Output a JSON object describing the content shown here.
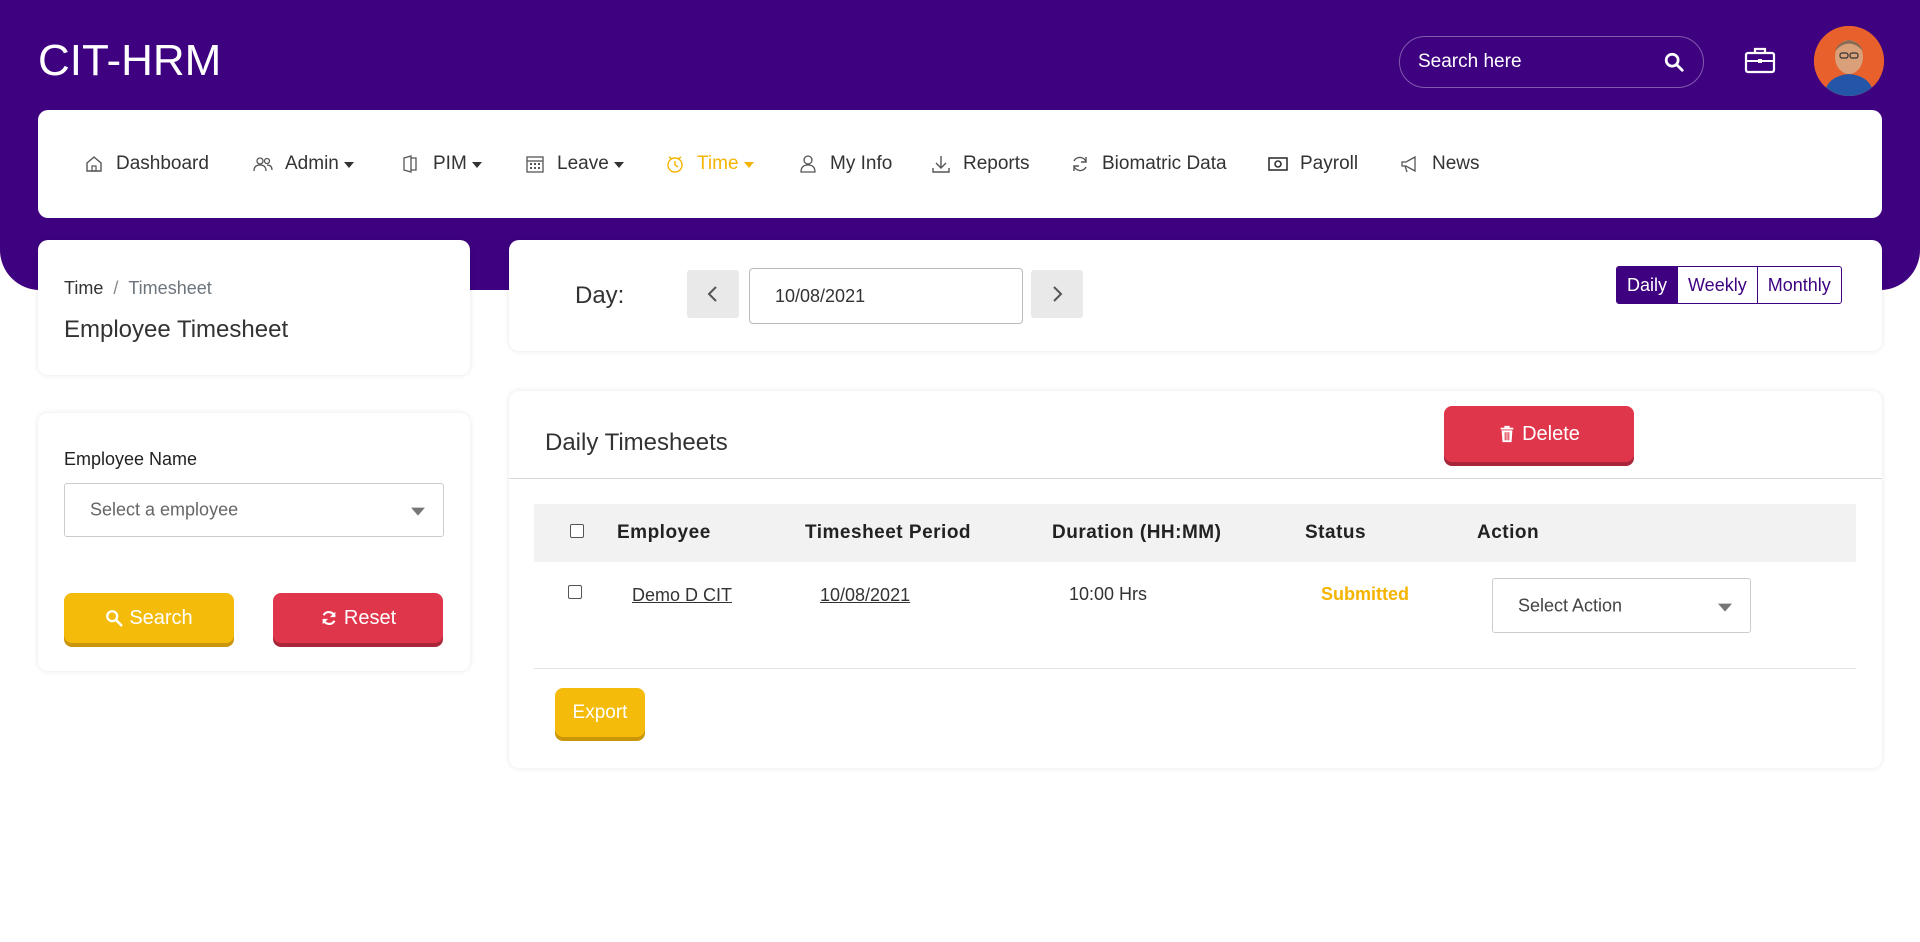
{
  "app": {
    "title": "CIT-HRM"
  },
  "header": {
    "search_placeholder": "Search here"
  },
  "nav": {
    "items": [
      {
        "label": "Dashboard",
        "icon": "home-icon"
      },
      {
        "label": "Admin",
        "icon": "users-icon",
        "dropdown": true
      },
      {
        "label": "PIM",
        "icon": "pim-icon",
        "dropdown": true
      },
      {
        "label": "Leave",
        "icon": "calendar-icon",
        "dropdown": true
      },
      {
        "label": "Time",
        "icon": "clock-icon",
        "dropdown": true,
        "active": true
      },
      {
        "label": "My Info",
        "icon": "user-icon"
      },
      {
        "label": "Reports",
        "icon": "download-icon"
      },
      {
        "label": "Biomatric Data",
        "icon": "refresh-icon"
      },
      {
        "label": "Payroll",
        "icon": "money-icon"
      },
      {
        "label": "News",
        "icon": "megaphone-icon"
      }
    ]
  },
  "breadcrumb": {
    "parent": "Time",
    "separator": "/",
    "current": "Timesheet"
  },
  "page": {
    "title": "Employee Timesheet"
  },
  "filter": {
    "employee_label": "Employee Name",
    "employee_placeholder": "Select a employee",
    "search_label": "Search",
    "reset_label": "Reset"
  },
  "day_selector": {
    "label": "Day:",
    "date": "10/08/2021",
    "views": [
      "Daily",
      "Weekly",
      "Monthly"
    ],
    "selected_view": "Daily"
  },
  "timesheets": {
    "title": "Daily Timesheets",
    "delete_label": "Delete",
    "columns": [
      "Employee",
      "Timesheet Period",
      "Duration (HH:MM)",
      "Status",
      "Action"
    ],
    "rows": [
      {
        "employee": "Demo D CIT",
        "period": "10/08/2021",
        "duration": "10:00 Hrs",
        "status": "Submitted",
        "action_placeholder": "Select Action"
      }
    ],
    "export_label": "Export"
  },
  "colors": {
    "brand": "#3e0280",
    "accent": "#f4b400",
    "danger": "#e0364b",
    "warning": "#f4bb0b"
  }
}
